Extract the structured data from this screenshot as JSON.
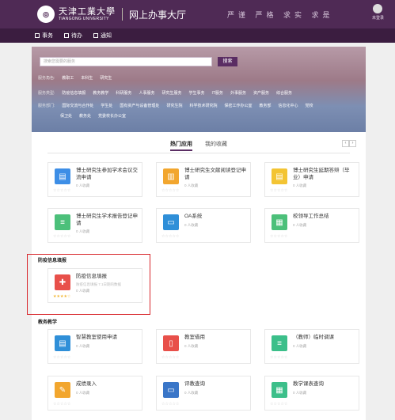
{
  "header": {
    "logo_cn": "天津工業大學",
    "logo_en": "TIANGONG UNIVERSITY",
    "title": "网上办事大厅",
    "motto": "严谨 严格 求实 求是",
    "user_label": "未登录"
  },
  "nav": {
    "items": [
      {
        "label": "事务"
      },
      {
        "label": "待办"
      },
      {
        "label": "通知"
      }
    ]
  },
  "search": {
    "placeholder": "搜索您需要的服务",
    "button": "搜索"
  },
  "filters": {
    "row1": {
      "label": "服务角色:",
      "items": [
        "教职工",
        "本科生",
        "研究生"
      ]
    },
    "row2": {
      "label": "服务类型:",
      "items": [
        "防疫信息填报",
        "教务教学",
        "科研服务",
        "人事服务",
        "研究生服务",
        "学生事务",
        "IT服务",
        "外事服务",
        "资产服务",
        "综合服务"
      ]
    },
    "row3": {
      "label": "服务部门:",
      "items": [
        "国际交流与合作处",
        "学生处",
        "国有资产与设备管理处",
        "研究生院",
        "科学技术研究院",
        "保密工作办公室",
        "教务部",
        "信息化中心",
        "党校"
      ]
    },
    "row4": {
      "items": [
        "保卫处",
        "教务处",
        "党委校长办公室"
      ]
    }
  },
  "tabs": {
    "active": "热门应用",
    "other": "我的收藏"
  },
  "hot_apps": [
    {
      "title": "博士研究生参加学术会议交流申请",
      "meta": "0 人收藏"
    },
    {
      "title": "博士研究生文献阅读登记申请",
      "meta": "0 人收藏"
    },
    {
      "title": "博士研究生延期答辩（毕业）申请",
      "meta": "0 人收藏"
    },
    {
      "title": "博士研究生学术报告登记申请",
      "meta": "0 人收藏"
    },
    {
      "title": "OA系统",
      "meta": "0 人收藏"
    },
    {
      "title": "校领导工作总结",
      "meta": "0 人收藏"
    }
  ],
  "sections": [
    {
      "title": "防疫信息填报",
      "apps": [
        {
          "title": "防疫信息填报",
          "desc": "防疫信息填报 7.1日期的数据",
          "meta": "0 人收藏"
        }
      ]
    },
    {
      "title": "教务教学",
      "apps": [
        {
          "title": "智慧教室使用申请",
          "meta": "0 人收藏"
        },
        {
          "title": "教室借用",
          "meta": "0 人收藏"
        },
        {
          "title": "（教师）临时调课",
          "meta": "0 人收藏"
        },
        {
          "title": "成绩录入",
          "meta": "0 人收藏"
        },
        {
          "title": "评教查询",
          "meta": "0 人收藏"
        },
        {
          "title": "教学课表查询",
          "meta": "0 人收藏"
        }
      ]
    }
  ],
  "colors": {
    "header": "#4f2a55",
    "navbar": "#3b1d40",
    "highlight": "#d8262b"
  }
}
